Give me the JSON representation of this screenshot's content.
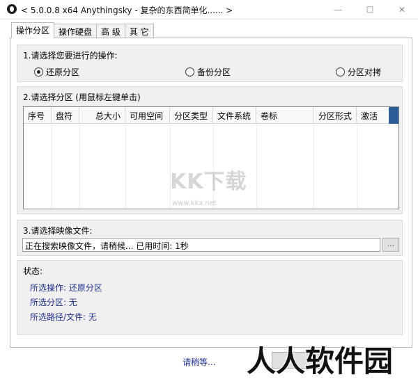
{
  "window": {
    "title": "< 5.0.0.8 x64 Anythingsky - 复杂的东西简单化...... >",
    "min_glyph": "—",
    "max_glyph": "☐",
    "close_glyph": "✕"
  },
  "tabs": [
    {
      "label": "操作分区",
      "active": true
    },
    {
      "label": "操作硬盘",
      "active": false
    },
    {
      "label": "高 级",
      "active": false
    },
    {
      "label": "其 它",
      "active": false
    }
  ],
  "step1": {
    "label": "1.请选择您要进行的操作:",
    "options": [
      {
        "label": "还原分区",
        "selected": true
      },
      {
        "label": "备份分区",
        "selected": false
      },
      {
        "label": "分区对拷",
        "selected": false
      }
    ]
  },
  "step2": {
    "label": "2.请选择分区 (用鼠标左键单击)",
    "columns": [
      "序号",
      "盘符",
      "总大小",
      "可用空间",
      "分区类型",
      "文件系统",
      "卷标",
      "分区形式",
      "激活"
    ]
  },
  "step3": {
    "label": "3.请选择映像文件:",
    "path_value": "正在搜索映像文件，请稍候...  已用时间: 1秒",
    "browse_label": "..."
  },
  "status": {
    "label": "状态:",
    "lines": [
      "所选操作: 还原分区",
      "所选分区: 无",
      "所选路径/文件: 无"
    ]
  },
  "bottom": {
    "status_text": "请稍等..."
  },
  "watermarks": {
    "kk_text": "KK下载",
    "kk_url": "www.kkx.net",
    "renren_text": "人人软件园"
  }
}
